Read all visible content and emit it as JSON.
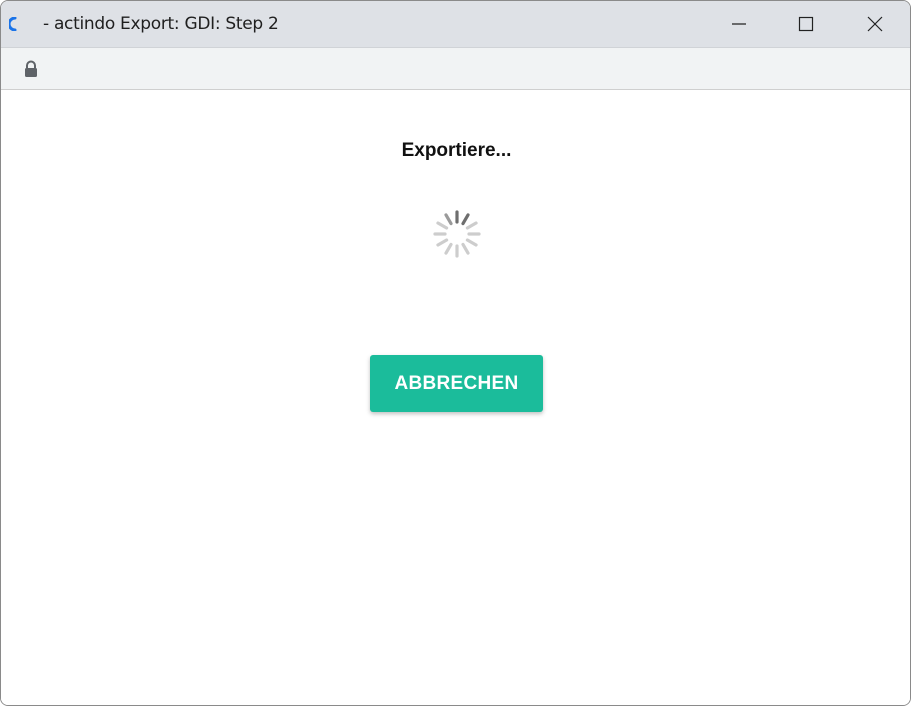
{
  "window": {
    "title": "- actindo Export: GDI: Step 2",
    "controls": [
      "minimize-icon",
      "maximize-icon",
      "close-icon"
    ]
  },
  "addressbar": {
    "icon": "lock-icon"
  },
  "main": {
    "heading": "Exportiere...",
    "spinner_icon": "loading-spinner-icon",
    "cancel_button": "ABBRECHEN"
  },
  "colors": {
    "accent": "#1bbc9b",
    "titlebar": "#dee1e6",
    "addressbar": "#f1f3f4",
    "favicon": "#1a73e8"
  }
}
